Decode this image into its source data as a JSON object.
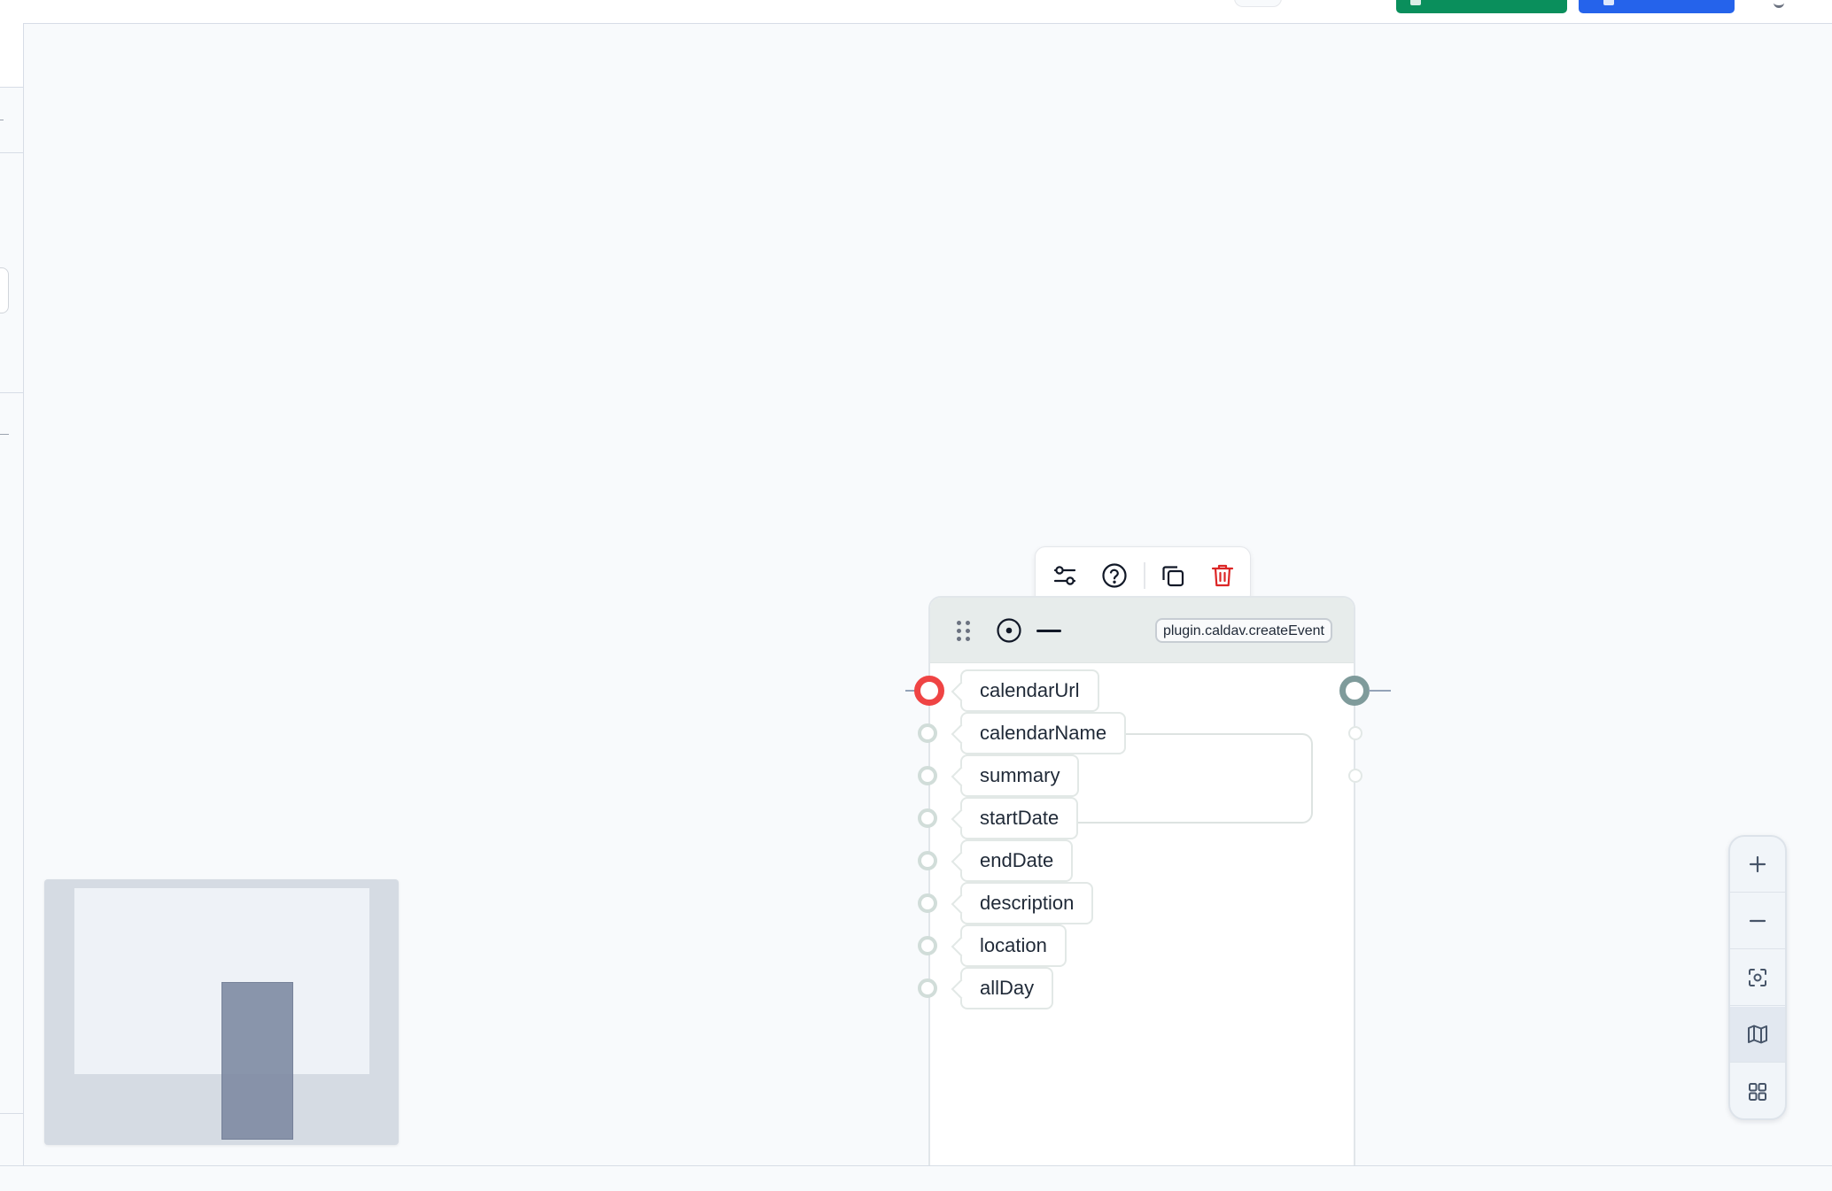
{
  "node": {
    "type_badge": "plugin.caldav.createEvent",
    "inputs": [
      {
        "label": "calendarUrl",
        "active": true
      },
      {
        "label": "calendarName",
        "active": false
      },
      {
        "label": "summary",
        "active": false
      },
      {
        "label": "startDate",
        "active": false
      },
      {
        "label": "endDate",
        "active": false
      },
      {
        "label": "description",
        "active": false
      },
      {
        "label": "location",
        "active": false
      },
      {
        "label": "allDay",
        "active": false
      }
    ]
  },
  "toolbar": {
    "icons": [
      "settings-sliders-icon",
      "help-circle-icon",
      "copy-icon",
      "trash-icon"
    ]
  },
  "controls": {
    "buttons": [
      "zoom-in-icon",
      "zoom-out-icon",
      "fit-view-icon",
      "minimap-toggle-icon",
      "grid-icon"
    ],
    "active": "minimap-toggle-icon"
  },
  "colors": {
    "active_port": "#ef4444",
    "output_port": "#7f9b9b",
    "delete_icon": "#dc2626",
    "primary_green": "#0a8f5c",
    "primary_blue": "#2563eb"
  }
}
